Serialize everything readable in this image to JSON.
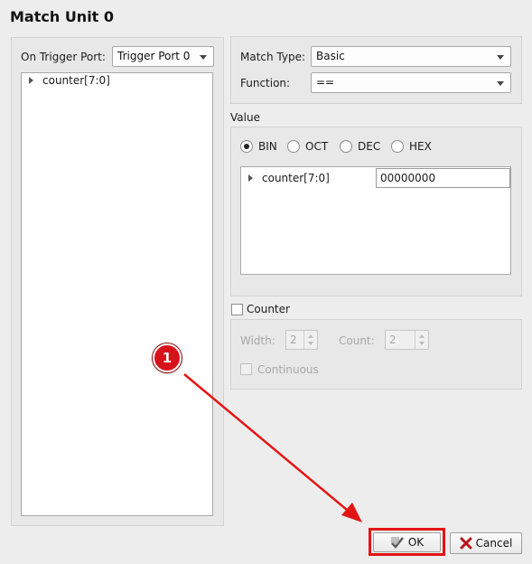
{
  "dialog": {
    "title": "Match Unit 0"
  },
  "left": {
    "trigger_port_label": "On Trigger Port:",
    "trigger_port_value": "Trigger Port 0",
    "tree_items": [
      {
        "label": "counter[7:0]"
      }
    ]
  },
  "match": {
    "type_label": "Match Type:",
    "type_value": "Basic",
    "function_label": "Function:",
    "function_value": "=="
  },
  "value": {
    "section_label": "Value",
    "radix_options": [
      {
        "label": "BIN",
        "checked": true
      },
      {
        "label": "OCT",
        "checked": false
      },
      {
        "label": "DEC",
        "checked": false
      },
      {
        "label": "HEX",
        "checked": false
      }
    ],
    "rows": [
      {
        "signal": "counter[7:0]",
        "value": "00000000"
      }
    ]
  },
  "counter": {
    "checkbox_label": "Counter",
    "width_label": "Width:",
    "width_value": "2",
    "count_label": "Count:",
    "count_value": "2",
    "continuous_label": "Continuous"
  },
  "buttons": {
    "ok_label": "OK",
    "cancel_label": "Cancel"
  },
  "annotation": {
    "marker_number": "1",
    "color": "#e31515"
  }
}
